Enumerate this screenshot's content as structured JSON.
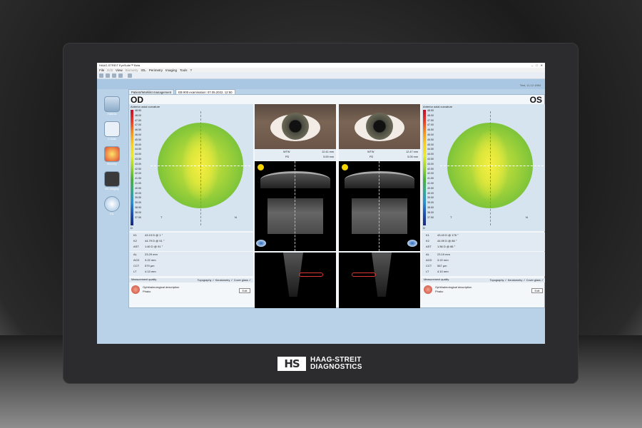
{
  "window": {
    "title": "HAAG-STREIT EyeSuite™ Beta"
  },
  "menu": [
    {
      "label": "File",
      "enabled": true
    },
    {
      "label": "Edit",
      "enabled": false
    },
    {
      "label": "View",
      "enabled": true
    },
    {
      "label": "Biometry",
      "enabled": false
    },
    {
      "label": "IOL",
      "enabled": true
    },
    {
      "label": "Perimetry",
      "enabled": true
    },
    {
      "label": "Imaging",
      "enabled": true
    },
    {
      "label": "Tools",
      "enabled": true
    },
    {
      "label": "?",
      "enabled": true
    }
  ],
  "tabs": [
    {
      "label": "Patient/Worklist management"
    },
    {
      "label": "EB 900 examination: 07.05.2022, 12:50"
    }
  ],
  "user": "Test, 11.12.1984",
  "nav": [
    {
      "label": "Patients",
      "icon": "patient-icon"
    },
    {
      "label": "E-Suite",
      "icon": "camera-icon"
    },
    {
      "label": "Biometry",
      "icon": "biometry-icon"
    },
    {
      "label": "IOL Imaging",
      "icon": "imaging-icon"
    },
    {
      "label": "IOL",
      "icon": "iol-icon"
    }
  ],
  "od": {
    "eye": "OD",
    "map_title": "Anterior axial curvature",
    "axis_t": "T",
    "axis_n": "N",
    "axis_d": "D",
    "scale": [
      "48.50",
      "48.00",
      "47.50",
      "47.00",
      "46.50",
      "46.00",
      "45.50",
      "45.00",
      "44.50",
      "44.00",
      "43.50",
      "43.00",
      "42.50",
      "42.00",
      "41.50",
      "41.00",
      "40.50",
      "40.00",
      "39.50",
      "39.00",
      "38.50",
      "38.00",
      "37.50"
    ],
    "k_rows": [
      {
        "label": "K1",
        "value": "43.19 D @ 1 °"
      },
      {
        "label": "K2",
        "value": "44.79 D @ 91 °"
      },
      {
        "label": "AST",
        "value": "1.60 D @ 91 °"
      }
    ],
    "bio_rows": [
      {
        "label": "AL",
        "value": "23.29 mm"
      },
      {
        "label": "ACD",
        "value": "3.22 mm"
      },
      {
        "label": "CCT",
        "value": "579 µm"
      },
      {
        "label": "LT",
        "value": "4.13 mm"
      }
    ],
    "wtw_label": "WTW",
    "wtw_value": "12.41 mm",
    "pd_label": "PD",
    "pd_value": "5.59 mm",
    "quality_label": "Measurement quality",
    "quality_value": "Topography ✓ Keratometry ✓ Cover glass ✓",
    "desc_title": "Ophthalmological description",
    "desc_value": "Phako",
    "edit": "Edit"
  },
  "os": {
    "eye": "OS",
    "map_title": "Anterior axial curvature",
    "axis_t": "T",
    "axis_n": "N",
    "axis_d": "D",
    "scale": [
      "48.50",
      "48.00",
      "47.50",
      "47.00",
      "46.50",
      "46.00",
      "45.50",
      "45.00",
      "44.50",
      "44.00",
      "43.50",
      "43.00",
      "42.50",
      "42.00",
      "41.50",
      "41.00",
      "40.50",
      "40.00",
      "39.50",
      "39.00",
      "38.50",
      "38.00",
      "37.50"
    ],
    "k_rows": [
      {
        "label": "K1",
        "value": "43.43 D @ 176 °"
      },
      {
        "label": "K2",
        "value": "44.99 D @ 86 °"
      },
      {
        "label": "AST",
        "value": "1.56 D @ 86 °"
      }
    ],
    "bio_rows": [
      {
        "label": "AL",
        "value": "23.19 mm"
      },
      {
        "label": "ACD",
        "value": "3.22 mm"
      },
      {
        "label": "CCT",
        "value": "567 µm"
      },
      {
        "label": "LT",
        "value": "4.10 mm"
      }
    ],
    "wtw_label": "WTW",
    "wtw_value": "12.47 mm",
    "pd_label": "PD",
    "pd_value": "5.05 mm",
    "quality_label": "Measurement quality",
    "quality_value": "Topography ✓ Keratometry ✓ Cover glass ✓",
    "desc_title": "Ophthalmological description",
    "desc_value": "Phako",
    "edit": "Edit"
  },
  "brand": {
    "mark": "HS",
    "line1": "HAAG-STREIT",
    "line2": "DIAGNOSTICS"
  }
}
